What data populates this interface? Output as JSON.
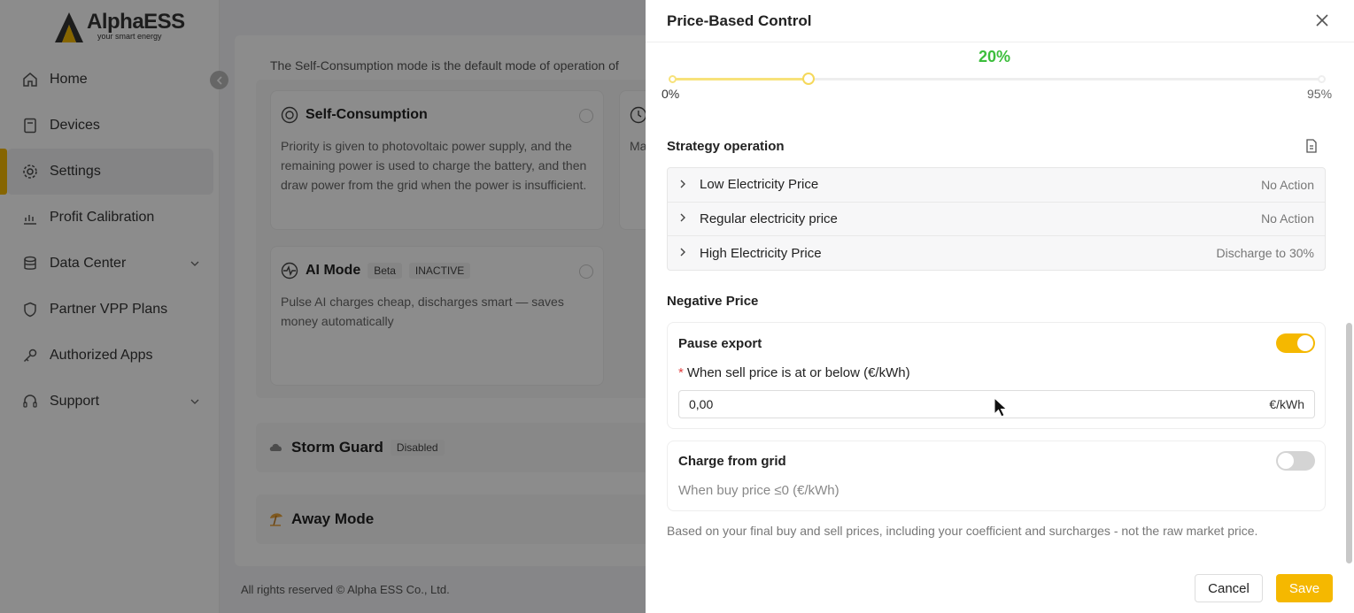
{
  "app": {
    "logo_name": "AlphaESS",
    "logo_tagline": "your smart energy",
    "sidebar": {
      "items": [
        {
          "label": "Home",
          "icon": "home-icon"
        },
        {
          "label": "Devices",
          "icon": "device-icon"
        },
        {
          "label": "Settings",
          "icon": "gear-icon",
          "active": true
        },
        {
          "label": "Profit Calibration",
          "icon": "chart-icon"
        },
        {
          "label": "Data Center",
          "icon": "database-icon",
          "expandable": true
        },
        {
          "label": "Partner VPP Plans",
          "icon": "shield-icon"
        },
        {
          "label": "Authorized Apps",
          "icon": "key-icon"
        },
        {
          "label": "Support",
          "icon": "headset-icon",
          "expandable": true
        }
      ]
    },
    "intro_text": "The Self-Consumption mode is the default mode of operation of",
    "modes": {
      "self_consumption": {
        "title": "Self-Consumption",
        "desc": "Priority is given to photovoltaic power supply, and the remaining power is used to charge the battery, and then draw power from the grid when the power is insufficient."
      },
      "partial_right_desc": "Ma",
      "ai_mode": {
        "title": "AI Mode",
        "badge_beta": "Beta",
        "badge_status": "INACTIVE",
        "desc": "Pulse AI charges cheap, discharges smart — saves money automatically"
      }
    },
    "storm_guard": {
      "title": "Storm Guard",
      "badge": "Disabled"
    },
    "away_mode": {
      "title": "Away Mode"
    },
    "footer": "All rights reserved © Alpha ESS Co., Ltd."
  },
  "drawer": {
    "title": "Price-Based Control",
    "slider": {
      "value_label": "20%",
      "min_label": "0%",
      "max_label": "95%",
      "value_fraction": 0.2105
    },
    "strategy": {
      "title": "Strategy operation",
      "rows": [
        {
          "label": "Low Electricity Price",
          "value": "No Action"
        },
        {
          "label": "Regular electricity price",
          "value": "No Action"
        },
        {
          "label": "High Electricity Price",
          "value": "Discharge to 30%"
        }
      ]
    },
    "negative_price": {
      "title": "Negative Price",
      "pause_export": {
        "title": "Pause export",
        "enabled": true,
        "field_label": "When sell price is at or below (€/kWh)",
        "required_mark": "*",
        "value": "0,00",
        "unit": "€/kWh"
      },
      "charge_from_grid": {
        "title": "Charge from grid",
        "enabled": false,
        "sub_text": "When buy price ≤0 (€/kWh)"
      }
    },
    "note": "Based on your final buy and sell prices, including your coefficient and surcharges - not the raw market price.",
    "cancel_label": "Cancel",
    "save_label": "Save"
  },
  "colors": {
    "accent": "#f5b800",
    "percent_green": "#3cbe3c"
  }
}
